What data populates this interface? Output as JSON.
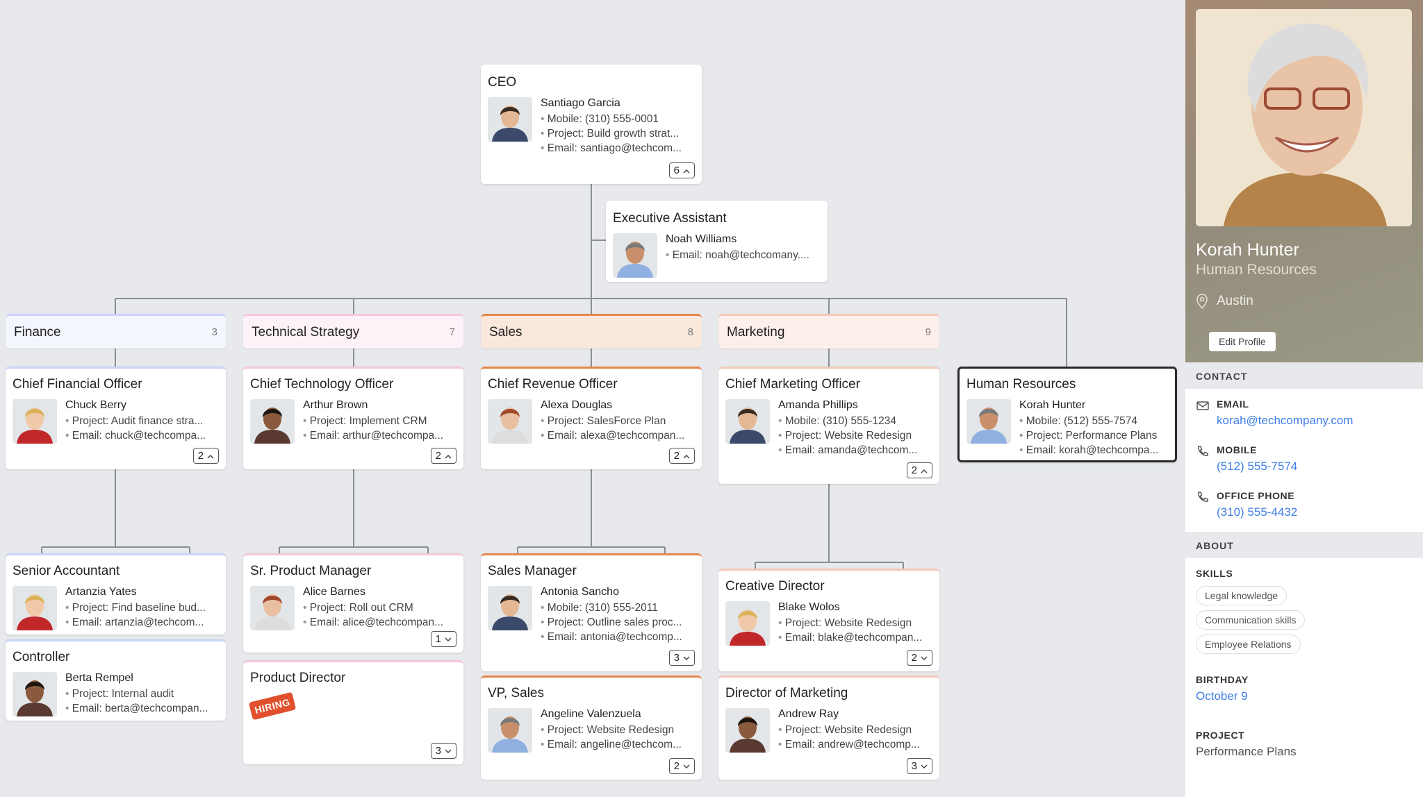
{
  "chart": {
    "ceo": {
      "title": "CEO",
      "name": "Santiago Garcia",
      "lines": [
        "Mobile: (310) 555-0001",
        "Project: Build growth strat...",
        "Email: santiago@techcom..."
      ],
      "count": "6",
      "expanded": true
    },
    "ea": {
      "title": "Executive Assistant",
      "name": "Noah Williams",
      "lines": [
        "Email: noah@techcomany...."
      ]
    },
    "departments": [
      {
        "key": "fin",
        "name": "Finance",
        "count": "3",
        "accent": "#c9d3fb",
        "bg": "#f4f6fe"
      },
      {
        "key": "tech",
        "name": "Technical Strategy",
        "count": "7",
        "accent": "#f5c6da",
        "bg": "#fdf2f7"
      },
      {
        "key": "sales",
        "name": "Sales",
        "count": "8",
        "accent": "#e8844a",
        "bg": "#fbe8dc"
      },
      {
        "key": "mkt",
        "name": "Marketing",
        "count": "9",
        "accent": "#f5c9b9",
        "bg": "#fdf0ec"
      }
    ],
    "cards": {
      "cfo": {
        "title": "Chief Financial Officer",
        "name": "Chuck Berry",
        "lines": [
          "Project: Audit finance stra...",
          "Email: chuck@techcompa..."
        ],
        "count": "2",
        "expanded": true
      },
      "cto": {
        "title": "Chief Technology Officer",
        "name": "Arthur Brown",
        "lines": [
          "Project: Implement CRM",
          "Email: arthur@techcompa..."
        ],
        "count": "2",
        "expanded": true
      },
      "cro": {
        "title": "Chief Revenue Officer",
        "name": "Alexa Douglas",
        "lines": [
          "Project: SalesForce Plan",
          "Email: alexa@techcompan..."
        ],
        "count": "2",
        "expanded": true
      },
      "cmo": {
        "title": "Chief Marketing Officer",
        "name": "Amanda Phillips",
        "lines": [
          "Mobile: (310) 555-1234",
          "Project: Website Redesign",
          "Email: amanda@techcom..."
        ],
        "count": "2",
        "expanded": true
      },
      "hr": {
        "title": "Human Resources",
        "name": "Korah Hunter",
        "lines": [
          "Mobile: (512) 555-7574",
          "Project: Performance Plans",
          "Email: korah@techcompa..."
        ]
      },
      "sa": {
        "title": "Senior Accountant",
        "name": "Artanzia Yates",
        "lines": [
          "Project: Find baseline bud...",
          "Email: artanzia@techcom..."
        ]
      },
      "ctrl": {
        "title": "Controller",
        "name": "Berta Rempel",
        "lines": [
          "Project: Internal audit",
          "Email: berta@techcompan..."
        ]
      },
      "spm": {
        "title": "Sr. Product Manager",
        "name": "Alice Barnes",
        "lines": [
          "Project: Roll out CRM",
          "Email: alice@techcompan..."
        ],
        "count": "1",
        "expanded": false
      },
      "pd": {
        "title": "Product Director",
        "hiring": "HIRING",
        "count": "3",
        "expanded": false
      },
      "sm": {
        "title": "Sales Manager",
        "name": "Antonia Sancho",
        "lines": [
          "Mobile: (310) 555-2011",
          "Project: Outline sales proc...",
          "Email: antonia@techcomp..."
        ],
        "count": "3",
        "expanded": false
      },
      "vp": {
        "title": "VP, Sales",
        "name": "Angeline Valenzuela",
        "lines": [
          "Project: Website Redesign",
          "Email: angeline@techcom..."
        ],
        "count": "2",
        "expanded": false
      },
      "cd": {
        "title": "Creative Director",
        "name": "Blake Wolos",
        "lines": [
          "Project: Website Redesign",
          "Email: blake@techcompan..."
        ],
        "count": "2",
        "expanded": false
      },
      "dm": {
        "title": "Director of Marketing",
        "name": "Andrew Ray",
        "lines": [
          "Project: Website Redesign",
          "Email: andrew@techcomp..."
        ],
        "count": "3",
        "expanded": false
      }
    }
  },
  "profile": {
    "name": "Korah Hunter",
    "department": "Human Resources",
    "location": "Austin",
    "edit_label": "Edit Profile",
    "contact_header": "CONTACT",
    "email_label": "EMAIL",
    "email": "korah@techcompany.com",
    "mobile_label": "MOBILE",
    "mobile": "(512) 555-7574",
    "office_label": "OFFICE PHONE",
    "office": "(310) 555-4432",
    "about_header": "ABOUT",
    "skills_label": "SKILLS",
    "skills": [
      "Legal knowledge",
      "Communication skills",
      "Employee Relations"
    ],
    "birthday_label": "BIRTHDAY",
    "birthday": "October 9",
    "project_label": "PROJECT",
    "project": "Performance Plans"
  },
  "colors": {
    "link": "#3f7ee8",
    "selected_border": "#2a2a2a",
    "background": "#e8e9ec"
  }
}
